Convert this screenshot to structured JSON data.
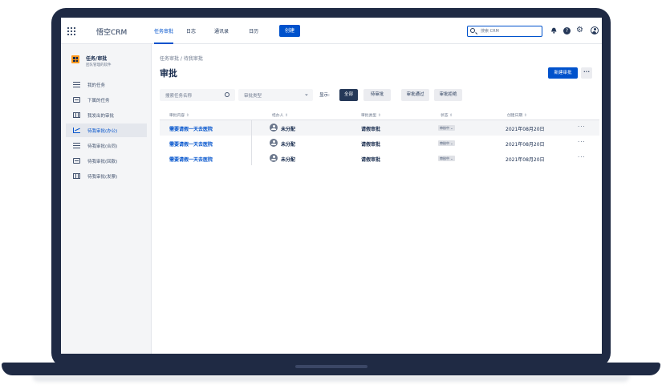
{
  "app": {
    "title": "悟空CRM"
  },
  "topnav": {
    "items": [
      "任务审批",
      "日志",
      "通讯录",
      "日历"
    ],
    "create_label": "创建",
    "search_placeholder": "搜索 CRM",
    "help_glyph": "?",
    "gear_glyph": "⚙"
  },
  "sidebar": {
    "project_title": "任务/审批",
    "project_subtitle": "团队管理的软件",
    "items": [
      {
        "label": "我的任务",
        "icon": "list-icon"
      },
      {
        "label": "下属的任务",
        "icon": "document-icon"
      },
      {
        "label": "我发出的审批",
        "icon": "columns-icon"
      },
      {
        "label": "待我审批(办公)",
        "icon": "chart-icon",
        "active": true
      },
      {
        "label": "待我审批(合同)",
        "icon": "list-icon"
      },
      {
        "label": "待我审批(回款)",
        "icon": "document-icon"
      },
      {
        "label": "待我审批(发票)",
        "icon": "columns-icon"
      }
    ]
  },
  "main": {
    "breadcrumb": "任务审批 / 待我审批",
    "title": "审批",
    "new_button": "新建审批",
    "more_glyph": "···",
    "filters": {
      "search_placeholder": "搜索任务名称",
      "type_placeholder": "审批类型",
      "chevron": "⌄",
      "show_label": "显示:",
      "chips": [
        "全部",
        "待审批",
        "审批通过",
        "审批拒绝"
      ],
      "active_chip": "全部"
    },
    "table": {
      "sort_glyph": "⇕",
      "columns": [
        "审批内容",
        "经办人",
        "审批类型",
        "状态",
        "创建日期"
      ],
      "rows": [
        {
          "content": "需要请假一天去医院",
          "assignee": "未分配",
          "type": "请假审批",
          "status": "审核中 ⌄",
          "date": "2021年08月20日",
          "more": "···"
        },
        {
          "content": "需要请假一天去医院",
          "assignee": "未分配",
          "type": "请假审批",
          "status": "审核中 ⌄",
          "date": "2021年08月20日",
          "more": "···"
        },
        {
          "content": "需要请假一天去医院",
          "assignee": "未分配",
          "type": "请假审批",
          "status": "审核中 ⌄",
          "date": "2021年08月20日",
          "more": "···"
        }
      ]
    }
  },
  "colors": {
    "accent": "#0052cc",
    "frame": "#1f2a44",
    "sidebar_bg": "#f4f5f7"
  }
}
